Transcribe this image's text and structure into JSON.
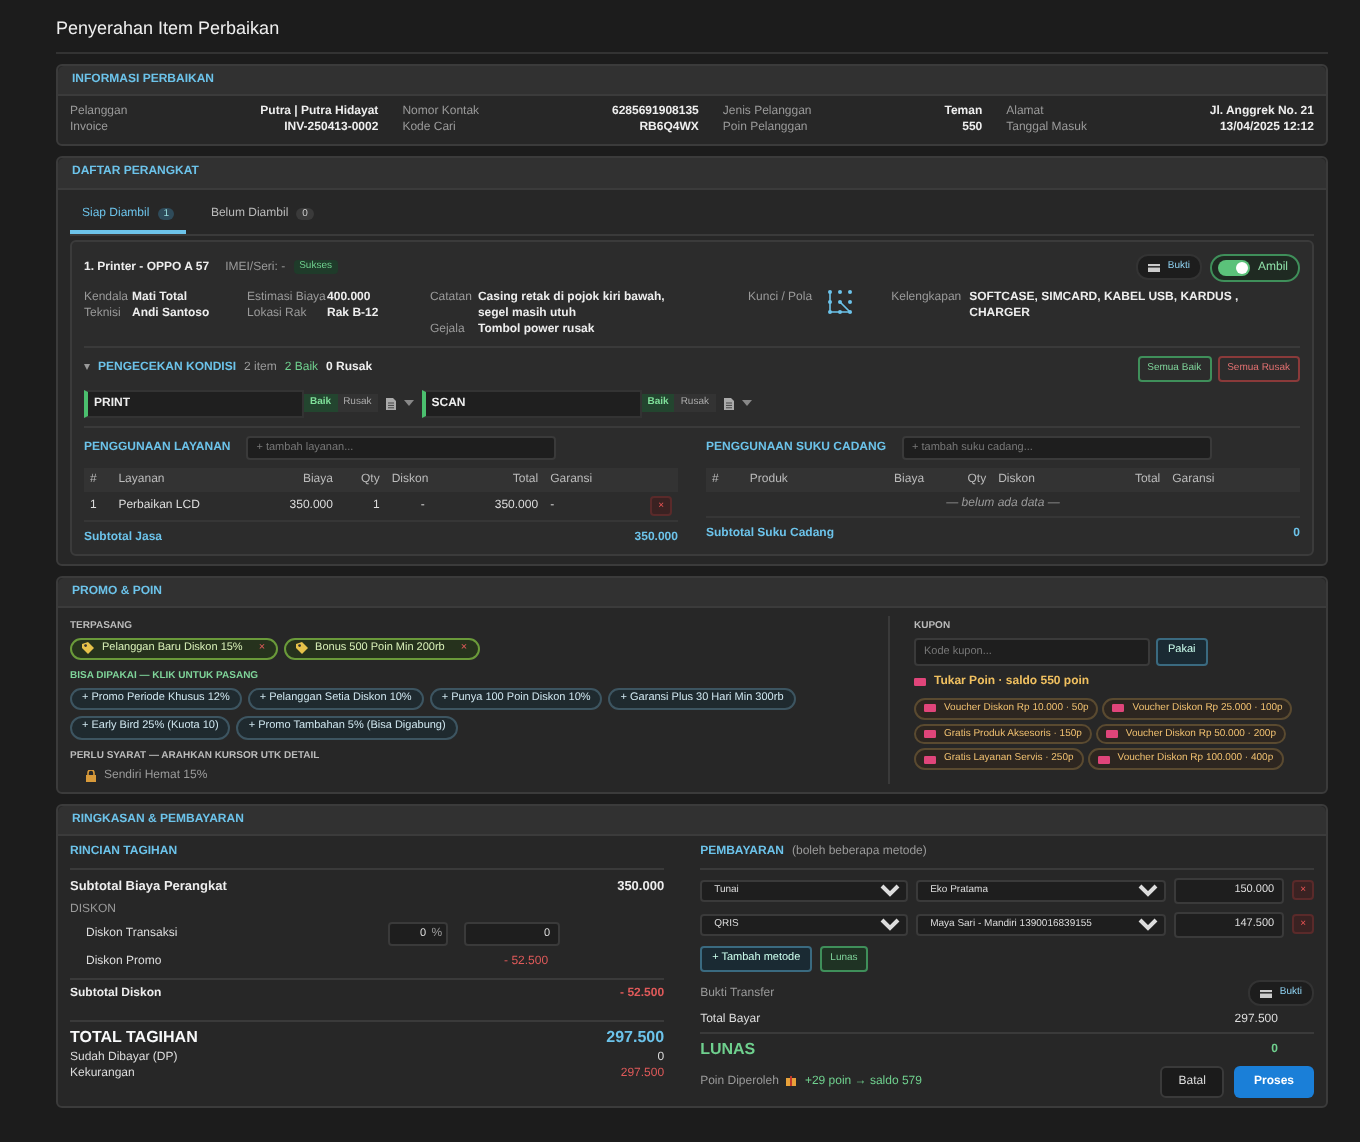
{
  "title": "Penyerahan Item Perbaikan",
  "info": {
    "heading": "INFORMASI PERBAIKAN",
    "fields": [
      {
        "label": "Pelanggan",
        "value": "Putra | Putra Hidayat"
      },
      {
        "label": "Invoice",
        "value": "INV-250413-0002"
      },
      {
        "label": "Nomor Kontak",
        "value": "6285691908135"
      },
      {
        "label": "Kode Cari",
        "value": "RB6Q4WX"
      },
      {
        "label": "Jenis Pelanggan",
        "value": "Teman"
      },
      {
        "label": "Poin Pelanggan",
        "value": "550"
      },
      {
        "label": "Alamat",
        "value": "Jl. Anggrek No. 21"
      },
      {
        "label": "Tanggal Masuk",
        "value": "13/04/2025 12:12"
      }
    ]
  },
  "devices": {
    "heading": "DAFTAR PERANGKAT",
    "tabs": [
      {
        "label": "Siap Diambil",
        "count": "1",
        "selected": true
      },
      {
        "label": "Belum Diambil",
        "count": "0",
        "selected": false
      }
    ],
    "device": {
      "title": "1. Printer - OPPO A 57",
      "imei": "IMEI/Seri: -",
      "status": "Sukses",
      "proof_button": "Bukti",
      "take_toggle": {
        "label": "Ambil",
        "on": true
      },
      "details": [
        [
          {
            "label": "Kendala",
            "value": "Mati Total"
          },
          {
            "label": "Teknisi",
            "value": "Andi Santoso"
          }
        ],
        [
          {
            "label": "Estimasi Biaya",
            "value": "400.000"
          },
          {
            "label": "Lokasi Rak",
            "value": "Rak B-12"
          }
        ],
        [
          {
            "label": "Catatan",
            "value": "Casing retak di pojok kiri bawah, segel masih utuh"
          },
          {
            "label": "Gejala",
            "value": "Tombol power rusak"
          }
        ]
      ],
      "lock_label": "Kunci / Pola",
      "accessories": {
        "label": "Kelengkapan",
        "value": "SOFTCASE, SIMCARD, KABEL USB, KARDUS , CHARGER"
      },
      "check": {
        "toggle_symbol": "▾",
        "heading": "PENGECEKAN KONDISI",
        "count": "2 item",
        "good": "2 Baik",
        "bad": "0 Rusak",
        "all_good": "Semua Baik",
        "all_bad": "Semua Rusak",
        "items": [
          {
            "name": "PRINT",
            "good_label": "Baik",
            "bad_label": "Rusak",
            "good": true
          },
          {
            "name": "SCAN",
            "good_label": "Baik",
            "bad_label": "Rusak",
            "good": true
          }
        ]
      },
      "services": {
        "heading": "PENGGUNAAN LAYANAN",
        "placeholder": "+ tambah layanan...",
        "columns": [
          "#",
          "Layanan",
          "Biaya",
          "Qty",
          "Diskon",
          "Total",
          "Garansi"
        ],
        "rows": [
          {
            "cells": [
              "1",
              "Perbaikan LCD",
              "350.000",
              "1",
              "-",
              "350.000",
              "-"
            ],
            "delete": "×"
          }
        ],
        "subtotal_label": "Subtotal Jasa",
        "subtotal": "350.000"
      },
      "parts": {
        "heading": "PENGGUNAAN SUKU CADANG",
        "placeholder": "+ tambah suku cadang...",
        "columns": [
          "#",
          "Produk",
          "Biaya",
          "Qty",
          "Diskon",
          "Total",
          "Garansi"
        ],
        "empty": "— belum ada data —",
        "subtotal_label": "Subtotal Suku Cadang",
        "subtotal": "0"
      }
    }
  },
  "promo": {
    "heading": "PROMO & POIN",
    "installed": {
      "label": "TERPASANG",
      "remove_symbol": "×",
      "items": [
        "Pelanggan Baru Diskon 15%",
        "Bonus 500 Poin Min 200rb"
      ]
    },
    "available": {
      "label": "BISA DIPAKAI — KLIK UNTUK PASANG",
      "add_symbol": "+",
      "items": [
        "Promo Periode Khusus 12%",
        "Pelanggan Setia Diskon 10%",
        "Punya 100 Poin Diskon 10%",
        "Garansi Plus 30 Hari Min 300rb",
        "Early Bird 25% (Kuota 10)",
        "Promo Tambahan 5% (Bisa Digabung)"
      ]
    },
    "requires": {
      "label": "PERLU SYARAT — ARAHKAN KURSOR UTK DETAIL",
      "items": [
        "Sendiri Hemat 15%"
      ]
    },
    "coupon": {
      "label": "KUPON",
      "placeholder": "Kode kupon...",
      "button": "Pakai"
    },
    "points": {
      "label": "Tukar Poin · saldo 550 poin",
      "vouchers": [
        "Voucher Diskon Rp 10.000 · 50p",
        "Voucher Diskon Rp 25.000 · 100p",
        "Gratis Produk Aksesoris · 150p",
        "Voucher Diskon Rp 50.000 · 200p",
        "Gratis Layanan Servis · 250p",
        "Voucher Diskon Rp 100.000 · 400p"
      ]
    }
  },
  "summary": {
    "heading": "RINGKASAN & PEMBAYARAN",
    "billing": {
      "heading": "RINCIAN TAGIHAN",
      "subtotal_label": "Subtotal Biaya Perangkat",
      "subtotal": "350.000",
      "discount_label": "DISKON",
      "transaction_label": "Diskon Transaksi",
      "percent": "0",
      "percent_unit": "%",
      "amount": "0",
      "promo_label": "Diskon Promo",
      "promo": "- 52.500",
      "discount_total_label": "Subtotal Diskon",
      "discount_total": "- 52.500",
      "total_label": "TOTAL TAGIHAN",
      "total": "297.500",
      "paid_label": "Sudah Dibayar (DP)",
      "paid": "0",
      "due_label": "Kekurangan",
      "due": "297.500"
    },
    "payment": {
      "heading": "PEMBAYARAN",
      "note": "(boleh beberapa metode)",
      "rows": [
        {
          "method": "Tunai",
          "account": "Eko Pratama",
          "amount": "150.000",
          "remove": "×"
        },
        {
          "method": "QRIS",
          "account": "Maya Sari - Mandiri 1390016839155",
          "amount": "147.500",
          "remove": "×"
        }
      ],
      "add_button": "+ Tambah metode",
      "paid_button": "Lunas",
      "proof_label": "Bukti Transfer",
      "proof_button": "Bukti",
      "total_label": "Total Bayar",
      "total": "297.500",
      "status": "LUNAS",
      "change": "0",
      "points_label": "Poin Diperoleh",
      "points": "+29 poin → saldo 579",
      "cancel": "Batal",
      "process": "Proses"
    }
  }
}
